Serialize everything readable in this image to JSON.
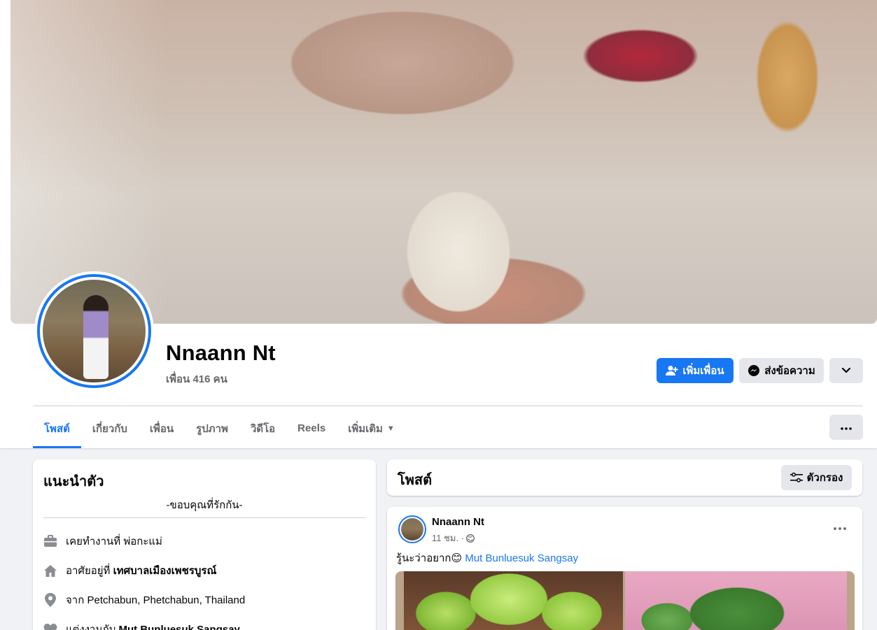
{
  "profile": {
    "name": "Nnaann Nt",
    "friends_count_label": "เพื่อน 416 คน"
  },
  "actions": {
    "add_friend": "เพิ่มเพื่อน",
    "message": "ส่งข้อความ"
  },
  "tabs": [
    {
      "label": "โพสต์",
      "active": true
    },
    {
      "label": "เกี่ยวกับ"
    },
    {
      "label": "เพื่อน"
    },
    {
      "label": "รูปภาพ"
    },
    {
      "label": "วิดีโอ"
    },
    {
      "label": "Reels"
    },
    {
      "label": "เพิ่มเติม"
    }
  ],
  "intro": {
    "title": "แนะนำตัว",
    "bio": "-ขอบคุณที่รักกัน-",
    "work_prefix": "เคยทำงานที่",
    "work_place": "พ่อกะแม่",
    "lives_prefix": "อาศัยอยู่ที่",
    "lives_place": "เทศบาลเมืองเพชรบูรณ์",
    "from_prefix": "จาก",
    "from_place": "Petchabun, Phetchabun, Thailand",
    "relationship_prefix": "แต่งงานกับ",
    "relationship_partner": "Mut Bunluesuk Sangsay"
  },
  "posts": {
    "title": "โพสต์",
    "filter_label": "ตัวกรอง"
  },
  "post": {
    "author": "Nnaann Nt",
    "time": "11 ชม. ·",
    "text": "รู้นะว่าอยาก😊",
    "mention": "Mut Bunluesuk Sangsay"
  },
  "colors": {
    "accent": "#1877f2",
    "secondary_button": "#e4e6eb",
    "page_background": "#f0f2f5",
    "muted_text": "#65676b"
  },
  "icons": [
    "add-friend-icon",
    "messenger-icon",
    "chevron-down-icon",
    "more-dots-icon",
    "filter-icon",
    "briefcase-icon",
    "home-icon",
    "location-pin-icon",
    "heart-icon",
    "globe-icon"
  ]
}
